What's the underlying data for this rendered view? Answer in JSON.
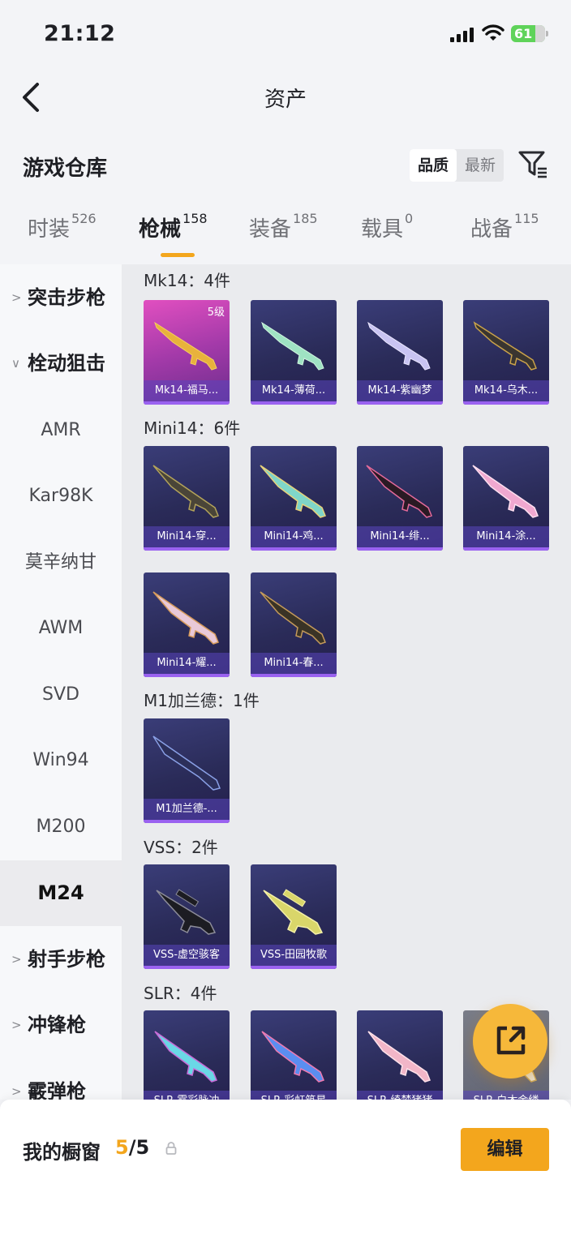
{
  "status_bar": {
    "time": "21:12",
    "battery": "61"
  },
  "nav": {
    "title": "资产"
  },
  "header": {
    "title": "游戏仓库",
    "sort_quality": "品质",
    "sort_latest": "最新"
  },
  "tabs": [
    {
      "label": "时装",
      "count": "526"
    },
    {
      "label": "枪械",
      "count": "158"
    },
    {
      "label": "装备",
      "count": "185"
    },
    {
      "label": "载具",
      "count": "0"
    },
    {
      "label": "战备",
      "count": "115"
    }
  ],
  "sidebar": {
    "groups": [
      "突击步枪",
      "栓动狙击",
      "射手步枪",
      "冲锋枪",
      "霰弹枪"
    ],
    "items": [
      "AMR",
      "Kar98K",
      "莫辛纳甘",
      "AWM",
      "SVD",
      "Win94",
      "M200",
      "M24"
    ]
  },
  "groups": [
    {
      "title": "Mk14：4件",
      "items": [
        {
          "name": "Mk14-福马...",
          "level": "5级"
        },
        {
          "name": "Mk14-薄荷..."
        },
        {
          "name": "Mk14-紫幽梦"
        },
        {
          "name": "Mk14-乌木..."
        }
      ]
    },
    {
      "title": "Mini14：6件",
      "items": [
        {
          "name": "Mini14-穿..."
        },
        {
          "name": "Mini14-鸡..."
        },
        {
          "name": "Mini14-绯..."
        },
        {
          "name": "Mini14-涂..."
        },
        {
          "name": "Mini14-耀..."
        },
        {
          "name": "Mini14-春..."
        }
      ]
    },
    {
      "title": "M1加兰德：1件",
      "items": [
        {
          "name": "M1加兰德-..."
        }
      ]
    },
    {
      "title": "VSS：2件",
      "items": [
        {
          "name": "VSS-虚空骇客"
        },
        {
          "name": "VSS-田园牧歌"
        }
      ]
    },
    {
      "title": "SLR：4件",
      "items": [
        {
          "name": "SLR-霓彩脉冲"
        },
        {
          "name": "SLR-彩虹筑星"
        },
        {
          "name": "SLR-绮梦猪猪"
        },
        {
          "name": "SLR-白木金缕"
        }
      ]
    }
  ],
  "showcase": {
    "title": "我的橱窗",
    "current": "5",
    "sep": "/",
    "total": "5",
    "edit_label": "编辑"
  },
  "colors": {
    "accent": "#f3a61d",
    "card": "#2a2b58",
    "label_bar": "#9a62f0"
  }
}
